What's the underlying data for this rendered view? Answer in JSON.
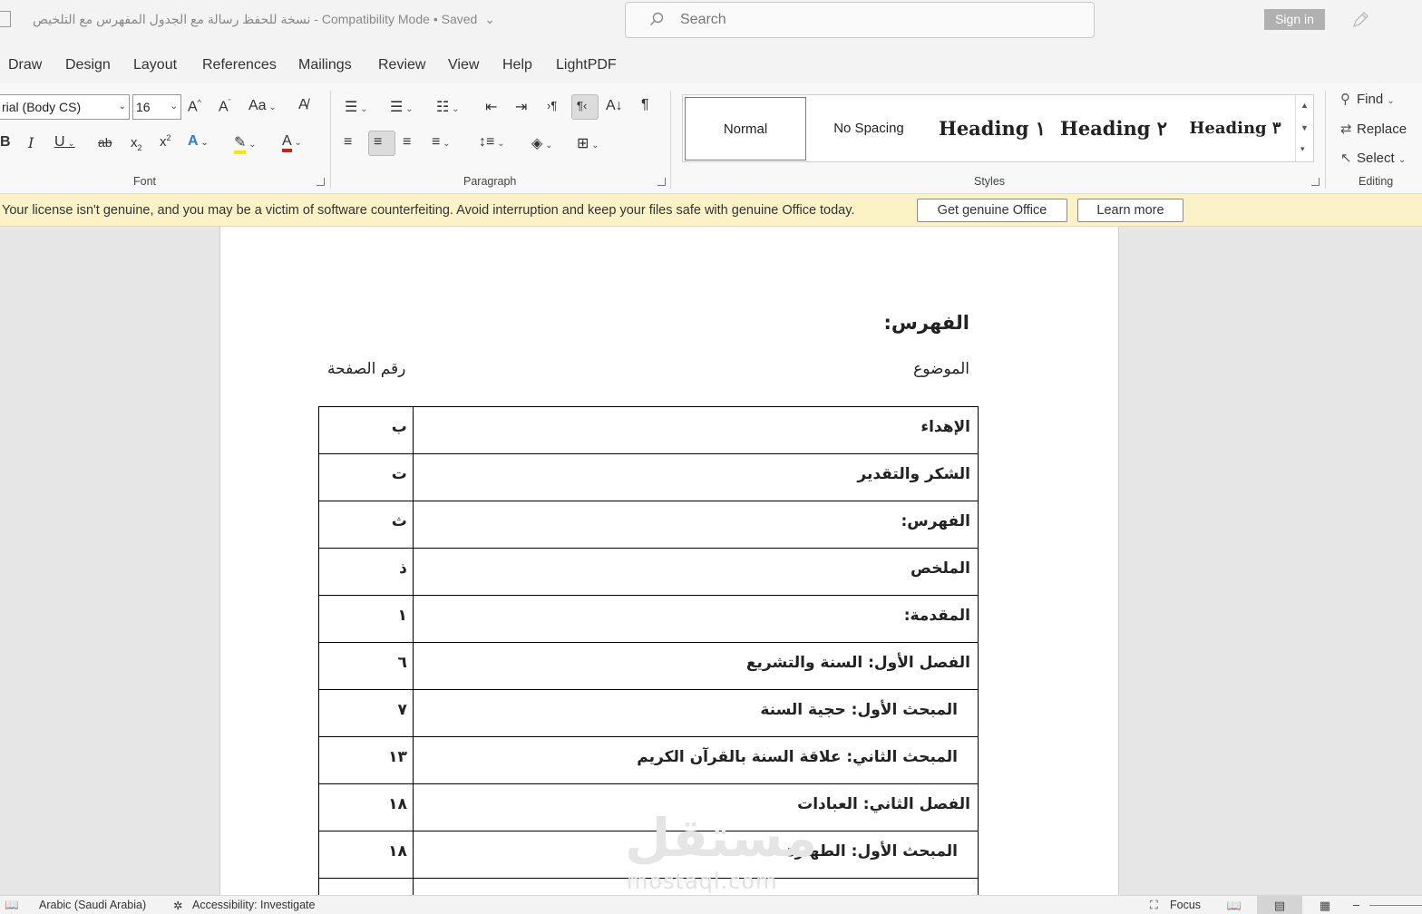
{
  "titlebar": {
    "doc_name": "نسخة للحفظ رسالة مع الجدول المفهرس مع التلخيص",
    "mode": "Compatibility Mode",
    "save_status": "Saved",
    "search_placeholder": "Search",
    "sign_in": "Sign in"
  },
  "menu": [
    "Draw",
    "Design",
    "Layout",
    "References",
    "Mailings",
    "Review",
    "View",
    "Help",
    "LightPDF"
  ],
  "font": {
    "name": "rial (Body CS)",
    "size": "16",
    "group_label": "Font"
  },
  "paragraph": {
    "group_label": "Paragraph"
  },
  "styles": {
    "group_label": "Styles",
    "items": [
      "Normal",
      "No Spacing",
      "Heading ١",
      "Heading ٢",
      "Heading ٣"
    ]
  },
  "editing": {
    "group_label": "Editing",
    "find": "Find",
    "replace": "Replace",
    "select": "Select"
  },
  "license": {
    "message": "Your license isn't genuine, and you may be a victim of software counterfeiting. Avoid interruption and keep your files safe with genuine Office today.",
    "get_genuine": "Get genuine Office",
    "learn_more": "Learn more"
  },
  "document": {
    "toc_title": "الفهرس:",
    "col_topic": "الموضوع",
    "col_page": "رقم الصفحة",
    "rows": [
      {
        "topic": "الإهداء",
        "page": "ب"
      },
      {
        "topic": "الشكر والتقدير",
        "page": "ت"
      },
      {
        "topic": "الفهرس:",
        "page": "ث"
      },
      {
        "topic": "الملخص",
        "page": "ذ"
      },
      {
        "topic": "المقدمة:",
        "page": "١"
      },
      {
        "topic": "الفصل الأول: السنة والتشريع",
        "page": "٦"
      },
      {
        "topic": "المبحث الأول: حجية السنة",
        "page": "٧"
      },
      {
        "topic": "المبحث الثاني: علاقة السنة بالقرآن الكريم",
        "page": "١٣"
      },
      {
        "topic": "الفصل الثاني: العبادات",
        "page": "١٨"
      },
      {
        "topic": "المبحث الأول: الطهارة",
        "page": "١٨"
      },
      {
        "topic": "",
        "page": ""
      }
    ],
    "watermark": "مستقل",
    "watermark_url": "mostaql.com"
  },
  "status": {
    "language": "Arabic (Saudi Arabia)",
    "accessibility": "Accessibility: Investigate",
    "focus": "Focus"
  }
}
